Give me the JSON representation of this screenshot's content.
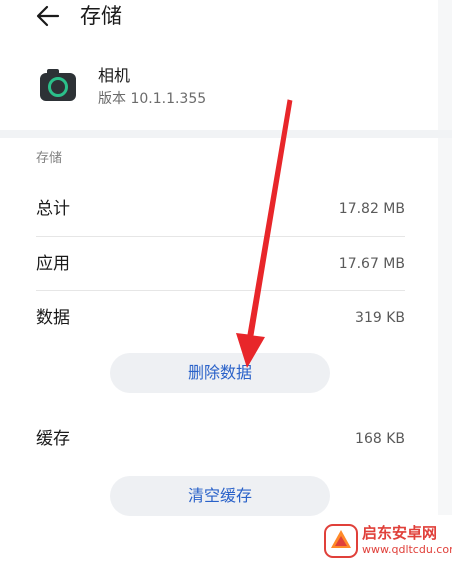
{
  "header": {
    "title": "存储",
    "back_icon": "arrow-left-icon"
  },
  "app": {
    "name": "相机",
    "version": "版本 10.1.1.355",
    "icon": "camera-icon",
    "icon_color": "#2bc08a"
  },
  "storage": {
    "section_label": "存储",
    "rows": [
      {
        "label": "总计",
        "value": "17.82 MB"
      },
      {
        "label": "应用",
        "value": "17.67 MB"
      },
      {
        "label": "数据",
        "value": "319 KB"
      }
    ],
    "clear_data_button": "删除数据"
  },
  "cache": {
    "label": "缓存",
    "value": "168 KB",
    "clear_cache_button": "清空缓存"
  },
  "annotation": {
    "arrow_color": "#e8262a"
  },
  "watermark": {
    "title": "启东安卓网",
    "url": "www.qdltcdu.com"
  },
  "colors": {
    "accent": "#2a62c9",
    "button_bg": "#eef0f3"
  }
}
